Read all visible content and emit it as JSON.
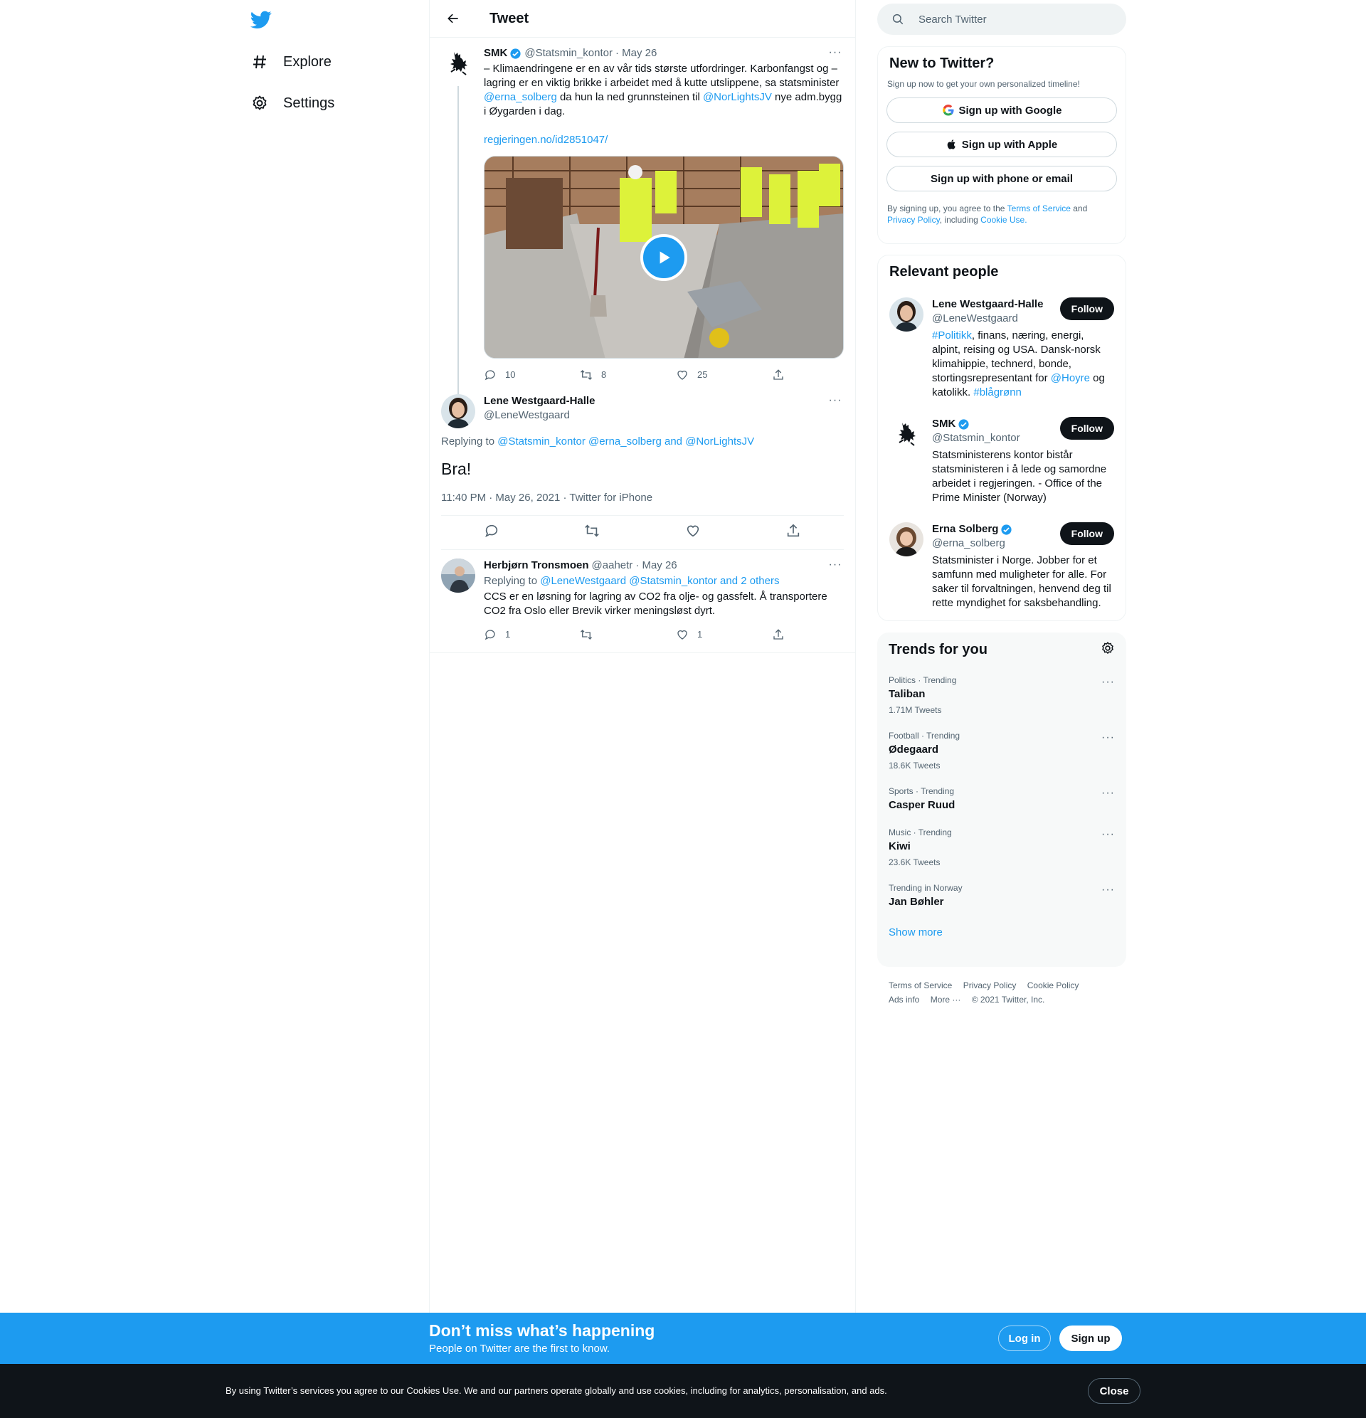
{
  "nav": {
    "explore": "Explore",
    "settings": "Settings"
  },
  "header": {
    "title": "Tweet"
  },
  "thread": {
    "author": "SMK",
    "handle": "@Statsmin_kontor",
    "date": "· May 26",
    "text_1": "– Klimaendringene er en av vår tids største utfordringer. Karbonfangst og – lagring er en viktig brikke i arbeidet med å kutte utslippene, sa statsminister ",
    "mention_1": "@erna_solberg",
    "text_2": " da hun la ned grunnsteinen til ",
    "mention_2": "@NorLightsJV",
    "text_3": " nye adm.bygg i Øygarden i dag.",
    "link": "regjeringen.no/id2851047/",
    "replies": "10",
    "retweets": "8",
    "likes": "25"
  },
  "focal": {
    "author": "Lene Westgaard-Halle",
    "handle": "@LeneWestgaard",
    "replying_prefix": "Replying to ",
    "replying_1": "@Statsmin_kontor",
    "replying_2": "@erna_solberg",
    "replying_and": " and ",
    "replying_3": "@NorLightsJV",
    "text": "Bra!",
    "meta": "11:40 PM · May 26, 2021 · Twitter for iPhone"
  },
  "reply": {
    "author": "Herbjørn Tronsmoen",
    "handle": "@aahetr",
    "date": "· May 26",
    "replying_prefix": "Replying to ",
    "replying_1": "@LeneWestgaard",
    "replying_2": "@Statsmin_kontor",
    "replying_rest": "and 2 others",
    "text": "CCS er en løsning for lagring av CO2 fra olje- og gassfelt. Å transportere CO2 fra Oslo eller Brevik virker meningsløst dyrt.",
    "replies": "1",
    "likes": "1"
  },
  "search": {
    "placeholder": "Search Twitter"
  },
  "new_to_twitter": {
    "title": "New to Twitter?",
    "subtitle": "Sign up now to get your own personalized timeline!",
    "google": "Sign up with Google",
    "apple": "Sign up with Apple",
    "phone": "Sign up with phone or email",
    "legal_1": "By signing up, you agree to the ",
    "terms": "Terms of Service",
    "legal_2": " and ",
    "privacy": "Privacy Policy",
    "legal_3": ", including ",
    "cookie": "Cookie Use."
  },
  "relevant": {
    "title": "Relevant people",
    "follow": "Follow",
    "people": [
      {
        "name": "Lene Westgaard-Halle",
        "handle": "@LeneWestgaard",
        "bio_tag": "#Politikk",
        "bio_1": ", finans, næring, energi, alpint, reising og USA. Dansk-norsk klimahippie, technerd, bonde, stortingsrepresentant for ",
        "bio_mention": "@Hoyre",
        "bio_2": " og katolikk. ",
        "bio_tag2": "#blågrønn"
      },
      {
        "name": "SMK",
        "handle": "@Statsmin_kontor",
        "bio": "Statsministerens kontor bistår statsministeren i å lede og samordne arbeidet i regjeringen. - Office of the Prime Minister (Norway)"
      },
      {
        "name": "Erna Solberg",
        "handle": "@erna_solberg",
        "bio": "Statsminister i Norge. Jobber for et samfunn med muligheter for alle. For saker til forvaltningen, henvend deg til rette myndighet for saksbehandling."
      }
    ]
  },
  "trends": {
    "title": "Trends for you",
    "items": [
      {
        "category": "Politics · Trending",
        "name": "Taliban",
        "count": "1.71M Tweets"
      },
      {
        "category": "Football · Trending",
        "name": "Ødegaard",
        "count": "18.6K Tweets"
      },
      {
        "category": "Sports · Trending",
        "name": "Casper Ruud",
        "count": ""
      },
      {
        "category": "Music · Trending",
        "name": "Kiwi",
        "count": "23.6K Tweets"
      },
      {
        "category": "Trending in Norway",
        "name": "Jan Bøhler",
        "count": ""
      }
    ],
    "show_more": "Show more"
  },
  "footer": {
    "terms": "Terms of Service",
    "privacy": "Privacy Policy",
    "cookie": "Cookie Policy",
    "ads": "Ads info",
    "more": "More ···",
    "copyright": "© 2021 Twitter, Inc."
  },
  "banner": {
    "title": "Don’t miss what’s happening",
    "subtitle": "People on Twitter are the first to know.",
    "login": "Log in",
    "signup": "Sign up"
  },
  "cookie_bar": {
    "text": "By using Twitter’s services you agree to our Cookies Use. We and our partners operate globally and use cookies, including for analytics, personalisation, and ads.",
    "close": "Close"
  },
  "colors": {
    "accent": "#1d9bf0",
    "text": "#0f1419",
    "muted": "#536471"
  }
}
